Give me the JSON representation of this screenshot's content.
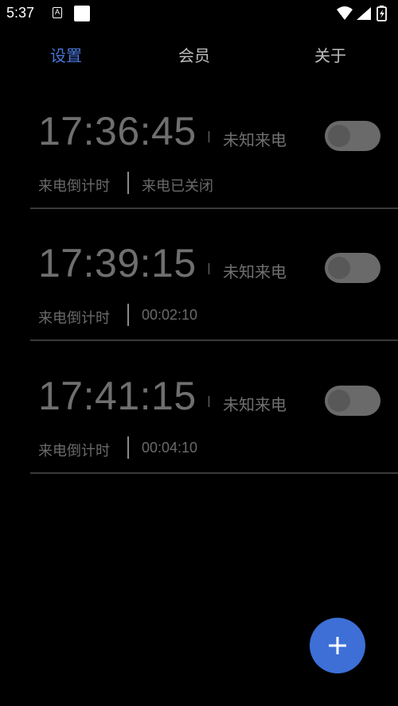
{
  "status_bar": {
    "time": "5:37",
    "icons": [
      "a-icon",
      "square-icon",
      "wifi-icon",
      "cell-signal-icon",
      "battery-icon"
    ]
  },
  "tabs": [
    {
      "label": "设置",
      "active": true
    },
    {
      "label": "会员",
      "active": false
    },
    {
      "label": "关于",
      "active": false
    }
  ],
  "alarms": [
    {
      "time": "17:36:45",
      "caller": "未知来电",
      "mode": "来电倒计时",
      "status": "来电已关闭",
      "enabled": false
    },
    {
      "time": "17:39:15",
      "caller": "未知来电",
      "mode": "来电倒计时",
      "status": "00:02:10",
      "enabled": false
    },
    {
      "time": "17:41:15",
      "caller": "未知来电",
      "mode": "来电倒计时",
      "status": "00:04:10",
      "enabled": false
    }
  ],
  "fab": {
    "icon": "plus-icon"
  },
  "colors": {
    "background": "#000000",
    "accent": "#4a74d6",
    "fab": "#3d6fd6",
    "text_muted": "#6f6f6f"
  }
}
